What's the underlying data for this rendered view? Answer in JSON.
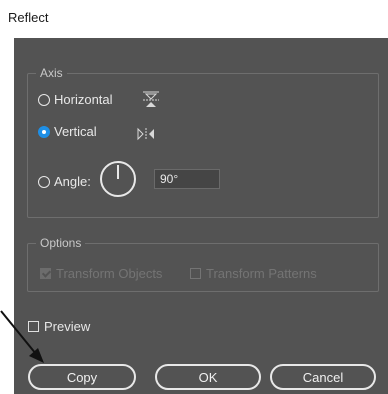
{
  "dialog": {
    "title": "Reflect"
  },
  "axis": {
    "legend": "Axis",
    "horizontal_label": "Horizontal",
    "vertical_label": "Vertical",
    "angle_label": "Angle:",
    "angle_value": "90°",
    "selected": "Vertical"
  },
  "options": {
    "legend": "Options",
    "transform_objects_label": "Transform Objects",
    "transform_objects_checked": true,
    "transform_patterns_label": "Transform Patterns",
    "transform_patterns_checked": false,
    "disabled": true
  },
  "preview": {
    "label": "Preview",
    "checked": false
  },
  "buttons": {
    "copy": "Copy",
    "ok": "OK",
    "cancel": "Cancel"
  },
  "colors": {
    "panel": "#535353",
    "radio_selected": "#1e8fe6",
    "text": "#e8e8e8",
    "disabled_text": "#747474"
  },
  "icons": {
    "horizontal_axis": "reflect-horizontal-icon",
    "vertical_axis": "reflect-vertical-icon",
    "angle_dial": "angle-dial-icon",
    "pointer": "arrow-pointer-icon"
  }
}
